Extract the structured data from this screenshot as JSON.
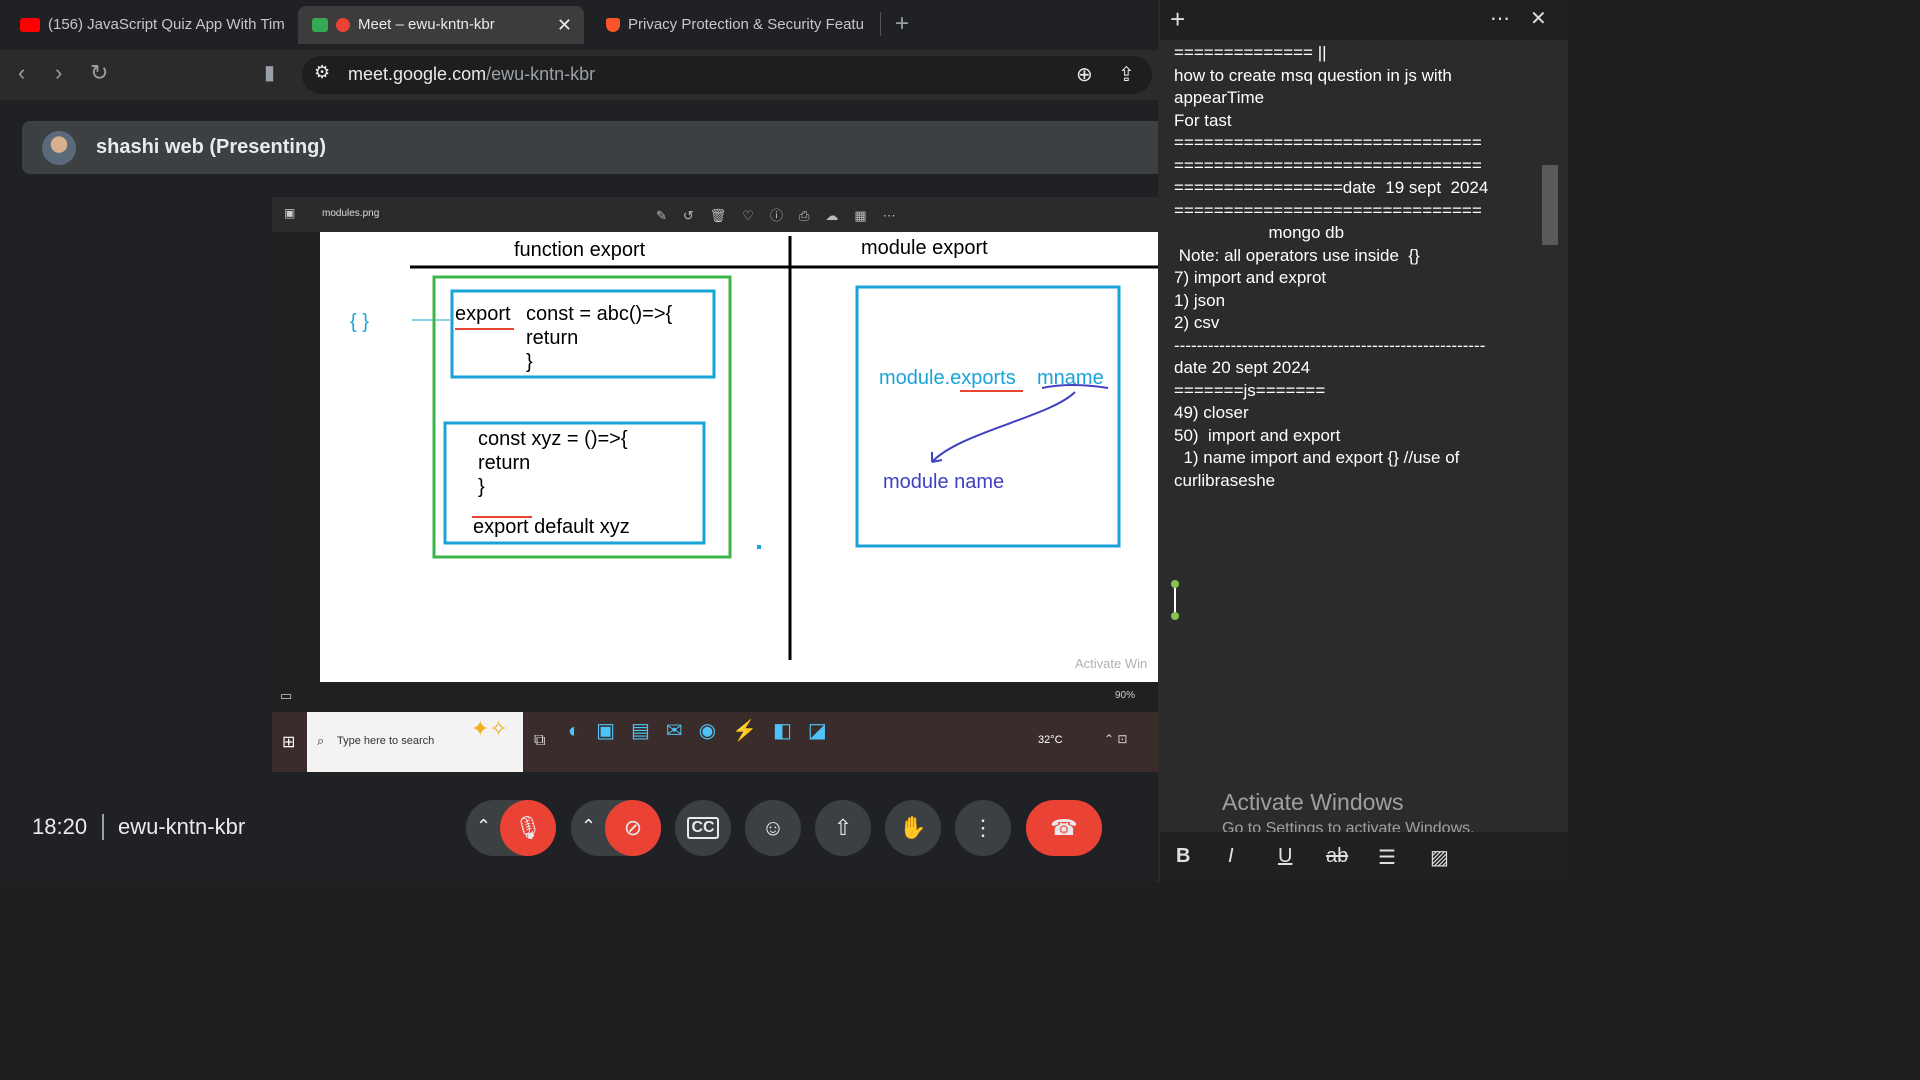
{
  "browser": {
    "tabs": [
      {
        "label": "(156) JavaScript Quiz App With Tim",
        "icon": "youtube-icon"
      },
      {
        "label": "Meet – ewu-kntn-kbr",
        "icon": "meet-icon",
        "active": true
      },
      {
        "label": "Privacy Protection & Security Featu",
        "icon": "brave-icon"
      }
    ],
    "url_host": "meet.google.com",
    "url_path": "/ewu-kntn-kbr"
  },
  "meet": {
    "presenter": "shashi web (Presenting)",
    "time": "18:20",
    "meeting_code": "ewu-kntn-kbr"
  },
  "shared": {
    "filename": "modules.png",
    "zoom": "90%",
    "search_placeholder": "Type here to search",
    "temperature": "32°C",
    "diagram": {
      "left_header": "function  export",
      "right_header": "module export",
      "braces": "{ }",
      "box1_line1a": "export",
      "box1_line1b": "const = abc()=>{",
      "box1_line2": "return",
      "box1_line3": "}",
      "box2_line1": "const xyz = ()=>{",
      "box2_line2": "return",
      "box2_line3": "}",
      "box2_export": "export default xyz",
      "module_exports": "module.exports",
      "mname": "mname",
      "module_name": "module name",
      "watermark": "Activate Win"
    }
  },
  "notepad": {
    "lines": [
      "============== ||",
      "",
      "how to create msq question in js with",
      "appearTime",
      "For tast",
      "",
      "",
      "===============================",
      "===============================",
      "=================date  19 sept  2024",
      "===============================",
      "                    mongo db",
      "",
      "",
      " Note: all operators use inside  {}",
      "",
      "",
      "7) import and exprot",
      "1) json",
      "2) csv",
      "",
      "",
      "",
      "",
      "",
      "",
      "-------------------------------------------------------",
      "date 20 sept 2024",
      "",
      "=======js=======",
      "49) closer",
      "50)  import and export",
      "  1) name import and export {} //use of",
      "curlibraseshe"
    ],
    "watermark_title": "Activate Windows",
    "watermark_sub": "Go to Settings to activate Windows."
  },
  "colors": {
    "red": "#ea4335",
    "box_blue": "#1aa3d9",
    "box_green": "#3cb54a",
    "text_blue": "#2f74c0"
  }
}
